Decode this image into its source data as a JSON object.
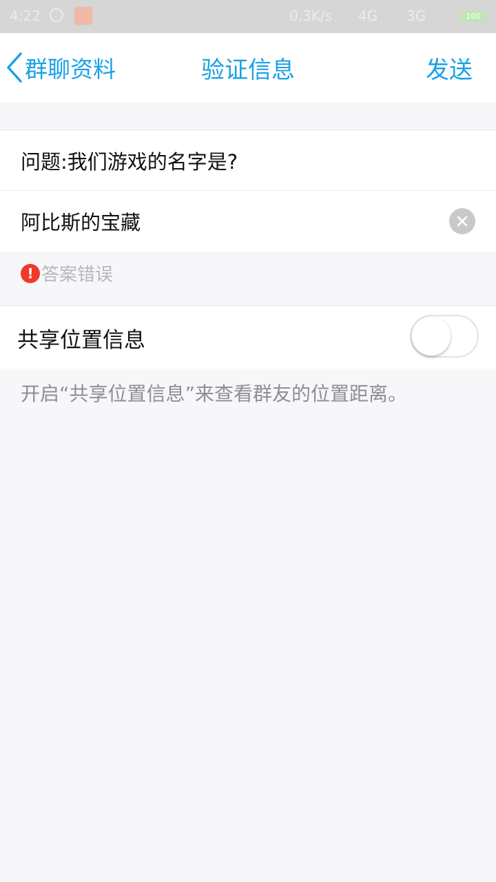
{
  "status_bar": {
    "time": "4:22",
    "network_speed": "0.3K/s",
    "signal_1": "4G",
    "signal_2": "3G",
    "battery": "100"
  },
  "nav": {
    "back_label": "群聊资料",
    "title": "验证信息",
    "action_label": "发送"
  },
  "form": {
    "question": "问题:我们游戏的名字是?",
    "answer_value": "阿比斯的宝藏",
    "error_text": "答案错误"
  },
  "location": {
    "toggle_label": "共享位置信息",
    "toggle_on": false,
    "hint": "开启“共享位置信息”来查看群友的位置距离。"
  },
  "colors": {
    "accent": "#1aa1e6",
    "error": "#ee3a2a",
    "background": "#f7f7f9"
  }
}
